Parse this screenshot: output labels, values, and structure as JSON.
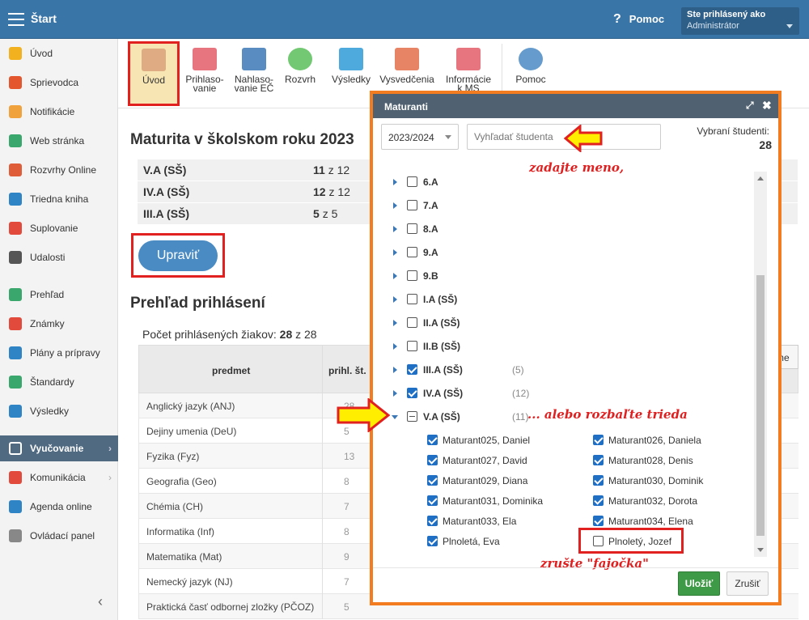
{
  "header": {
    "app_title": "Štart",
    "help": "Pomoc",
    "help_glyph": "?",
    "user_line1": "Ste prihlásený ako",
    "user_line2": "Administrátor"
  },
  "sidebar": {
    "items": [
      {
        "label": "Úvod",
        "icon": "star-icon",
        "color": "#f2b21f"
      },
      {
        "label": "Sprievodca",
        "icon": "wand-icon",
        "color": "#e4572e"
      },
      {
        "label": "Notifikácie",
        "icon": "envelope-icon",
        "color": "#f0a33c"
      },
      {
        "label": "Web stránka",
        "icon": "home-icon",
        "color": "#3aa76d"
      },
      {
        "label": "Rozvrhy Online",
        "icon": "grid-icon",
        "color": "#e05d3a"
      },
      {
        "label": "Triedna kniha",
        "icon": "book-icon",
        "color": "#2f84c6"
      },
      {
        "label": "Suplovanie",
        "icon": "person-icon",
        "color": "#e24b3b"
      },
      {
        "label": "Udalosti",
        "icon": "calendar-icon",
        "color": "#555555"
      },
      {
        "label": "Prehľad",
        "icon": "check-circle-icon",
        "color": "#3aa76d"
      },
      {
        "label": "Známky",
        "icon": "grade-icon",
        "color": "#e24b3b"
      },
      {
        "label": "Plány a prípravy",
        "icon": "briefcase-icon",
        "color": "#2f84c6"
      },
      {
        "label": "Štandardy",
        "icon": "shield-icon",
        "color": "#3aa76d"
      },
      {
        "label": "Výsledky",
        "icon": "bar-chart-icon",
        "color": "#2f84c6"
      },
      {
        "label": "Vyučovanie",
        "icon": "book-open-icon",
        "color": "#ffffff",
        "active": true
      },
      {
        "label": "Komunikácia",
        "icon": "chat-icon",
        "color": "#e24b3b"
      },
      {
        "label": "Agenda online",
        "icon": "pen-icon",
        "color": "#2f84c6"
      },
      {
        "label": "Ovládací panel",
        "icon": "gear-icon",
        "color": "#888888"
      }
    ],
    "collapse_glyph": "‹"
  },
  "toolbar": {
    "items": [
      {
        "label": "Úvod",
        "icon": "graduates-icon"
      },
      {
        "label": "Prihlaso-\nvanie",
        "icon": "form-icon"
      },
      {
        "label": "Nahlaso-\nvanie EČ",
        "icon": "export-icon"
      },
      {
        "label": "Rozvrh",
        "icon": "clock-icon"
      },
      {
        "label": "Výsledky",
        "icon": "bar-chart-icon"
      },
      {
        "label": "Vysvedčenia",
        "icon": "certificate-icon"
      },
      {
        "label": "Informácie\nk MS",
        "icon": "info-doc-icon"
      },
      {
        "label": "Pomoc",
        "icon": "help-icon"
      }
    ]
  },
  "main": {
    "title": "Maturita v školskom roku 2023",
    "classes": [
      {
        "name": "V.A (SŠ)",
        "done": "11",
        "of": "z 12"
      },
      {
        "name": "IV.A (SŠ)",
        "done": "12",
        "of": "z 12"
      },
      {
        "name": "III.A (SŠ)",
        "done": "5",
        "of": "z 5"
      }
    ],
    "edit_button": "Upraviť",
    "section_title": "Prehľad prihlásení",
    "count_label": "Počet prihlásených žiakov:",
    "count_value": "28",
    "count_of": "z 28",
    "table_head": {
      "subject": "predmet",
      "count": "prihl. št."
    },
    "right_button": "me",
    "subjects": [
      {
        "name": "Anglický jazyk (ANJ)",
        "count": "28"
      },
      {
        "name": "Dejiny umenia (DeU)",
        "count": "5"
      },
      {
        "name": "Fyzika (Fyz)",
        "count": "13"
      },
      {
        "name": "Geografia (Geo)",
        "count": "8"
      },
      {
        "name": "Chémia (CH)",
        "count": "7"
      },
      {
        "name": "Informatika (Inf)",
        "count": "8"
      },
      {
        "name": "Matematika (Mat)",
        "count": "9"
      },
      {
        "name": "Nemecký jazyk (NJ)",
        "count": "7"
      },
      {
        "name": "Praktická časť odbornej zložky (PČOZ)",
        "count": "5"
      }
    ]
  },
  "modal": {
    "title": "Maturanti",
    "year": "2023/2024",
    "search_placeholder": "Vyhľadať študenta",
    "selected_label": "Vybraní študenti:",
    "selected_count": "28",
    "hint_name": "zadajte meno,",
    "hint_expand": "... alebo rozbaľte trieda",
    "hint_check": "zrušte \"fajočka\"",
    "tree": [
      {
        "label": "6.A",
        "checked": false
      },
      {
        "label": "7.A",
        "checked": false
      },
      {
        "label": "8.A",
        "checked": false
      },
      {
        "label": "9.A",
        "checked": false
      },
      {
        "label": "9.B",
        "checked": false
      },
      {
        "label": "I.A (SŠ)",
        "checked": false
      },
      {
        "label": "II.A (SŠ)",
        "checked": false
      },
      {
        "label": "II.B (SŠ)",
        "checked": false
      },
      {
        "label": "III.A (SŠ)",
        "checked": true,
        "count": "(5)"
      },
      {
        "label": "IV.A (SŠ)",
        "checked": true,
        "count": "(12)"
      },
      {
        "label": "V.A (SŠ)",
        "checked": "partial",
        "count": "(11)",
        "open": true
      }
    ],
    "students": [
      {
        "name": "Maturant025, Daniel",
        "checked": true
      },
      {
        "name": "Maturant026, Daniela",
        "checked": true
      },
      {
        "name": "Maturant027, David",
        "checked": true
      },
      {
        "name": "Maturant028, Denis",
        "checked": true
      },
      {
        "name": "Maturant029, Diana",
        "checked": true
      },
      {
        "name": "Maturant030, Dominik",
        "checked": true
      },
      {
        "name": "Maturant031, Dominika",
        "checked": true
      },
      {
        "name": "Maturant032, Dorota",
        "checked": true
      },
      {
        "name": "Maturant033, Ela",
        "checked": true
      },
      {
        "name": "Maturant034, Elena",
        "checked": true
      },
      {
        "name": "Plnoletá, Eva",
        "checked": true
      },
      {
        "name": "Plnoletý, Jozef",
        "checked": false
      }
    ],
    "save": "Uložiť",
    "cancel": "Zrušiť"
  }
}
